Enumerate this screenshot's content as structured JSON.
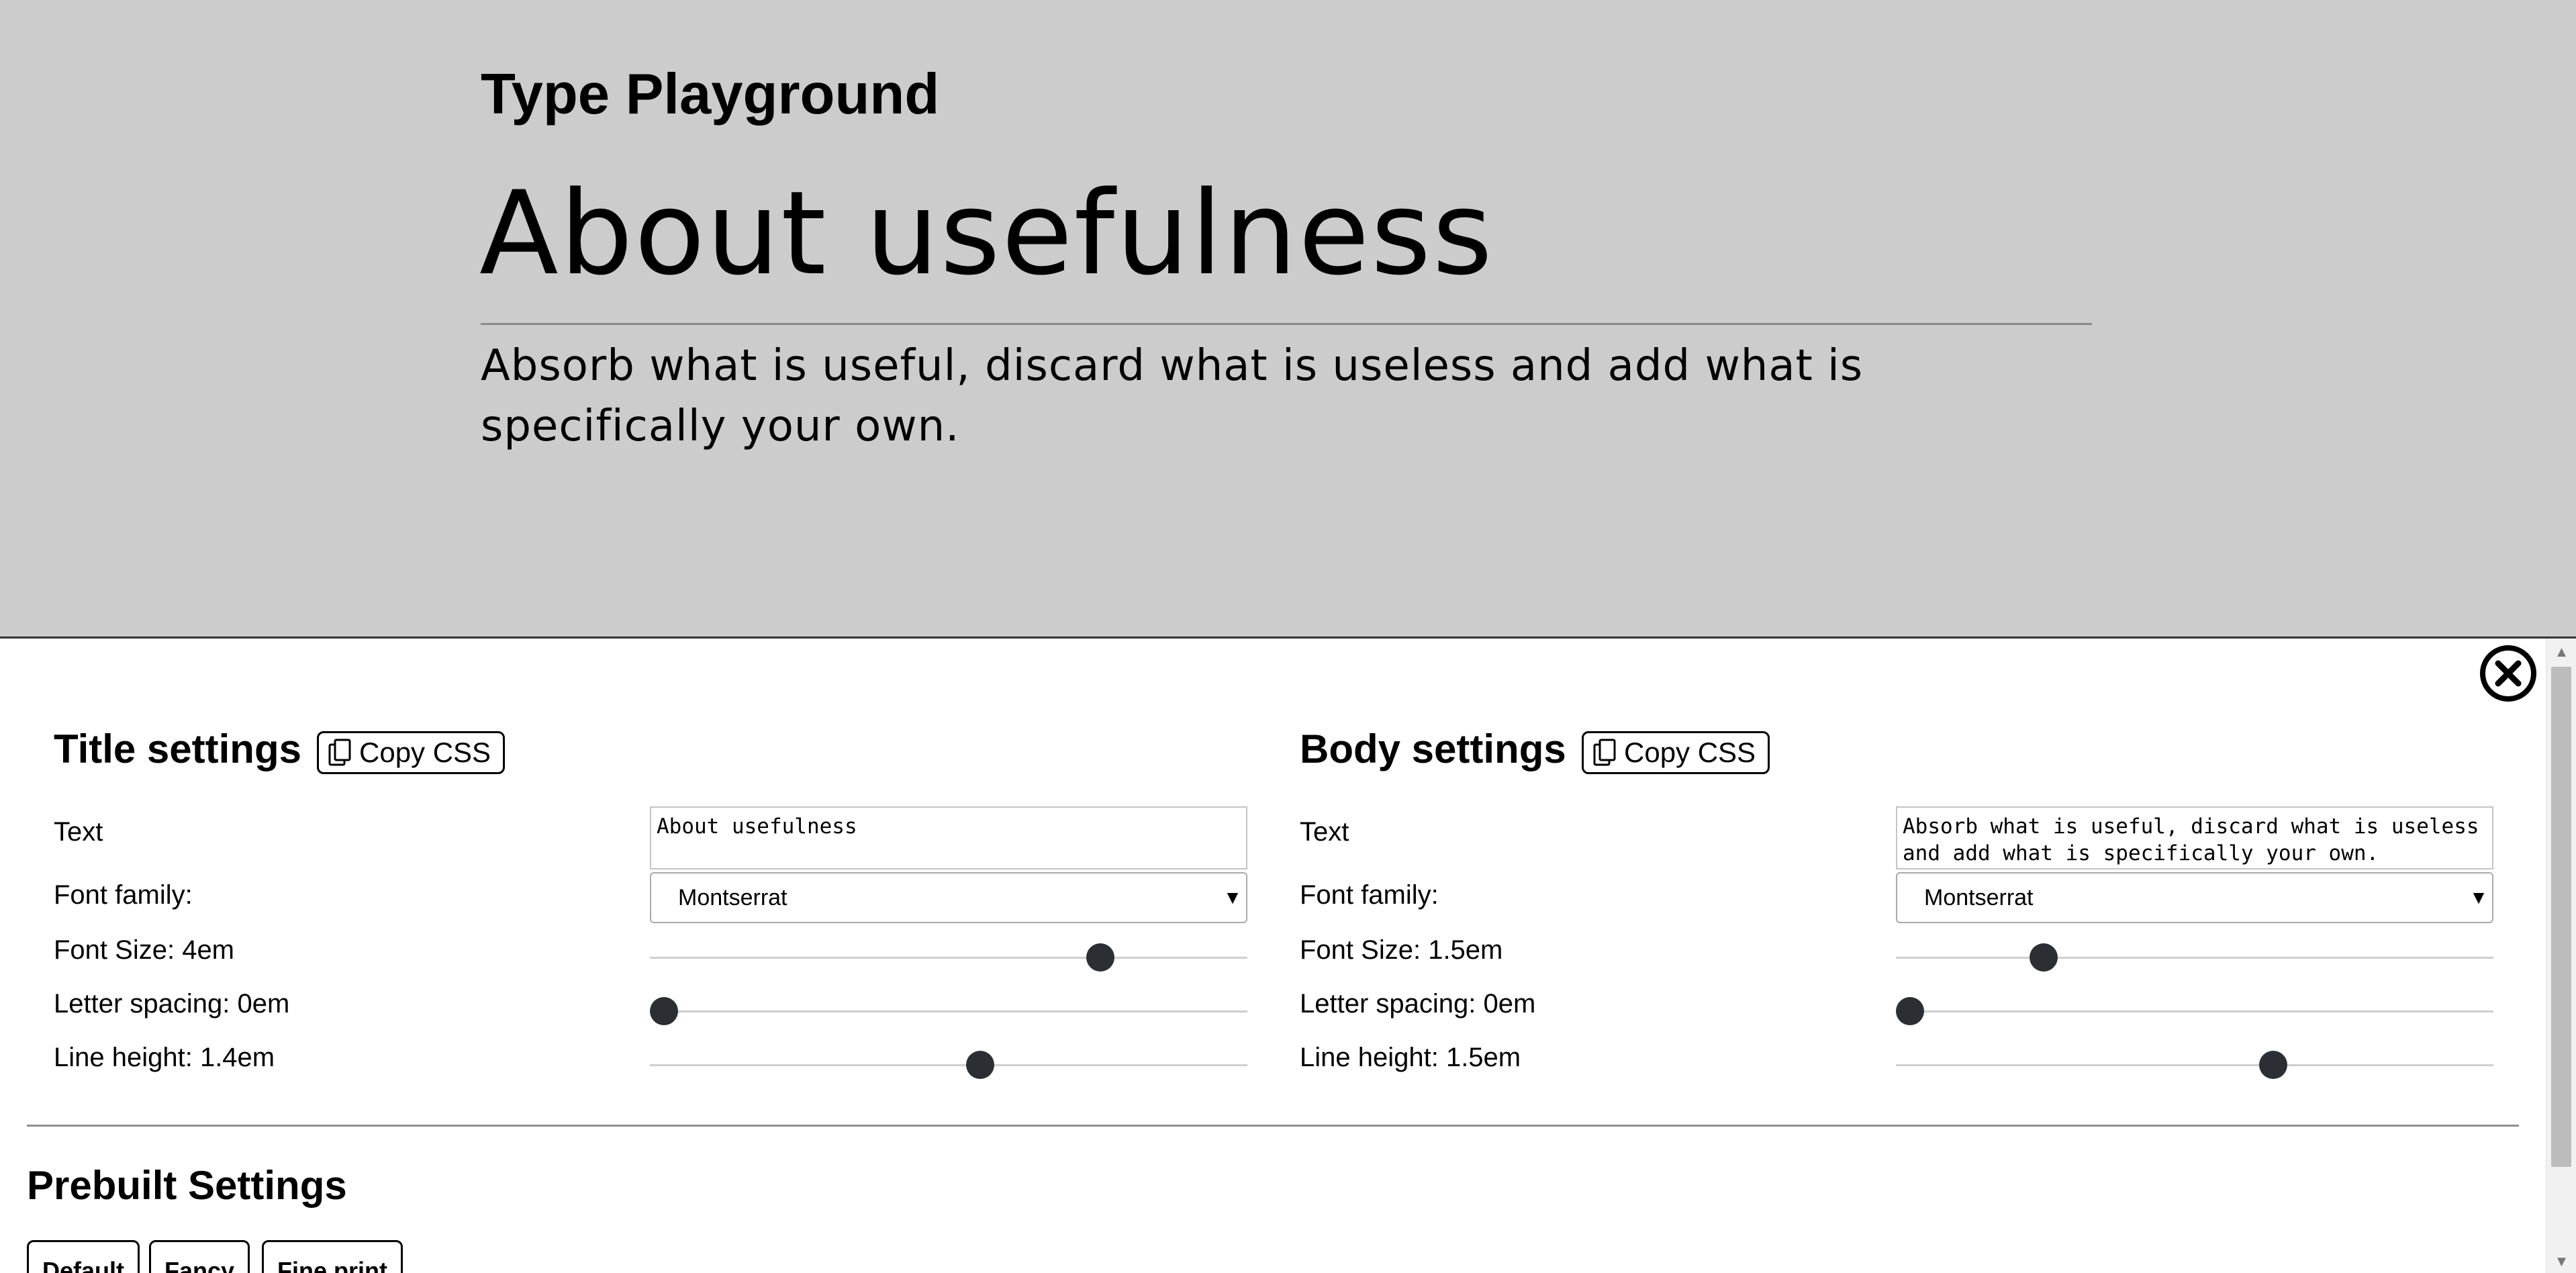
{
  "app": {
    "title": "Type Playground"
  },
  "preview": {
    "heading": "About usefulness",
    "body": "Absorb what is useful, discard what is useless and add what is specifically your own."
  },
  "title_settings": {
    "heading": "Title settings",
    "copy_label": "Copy CSS",
    "text_label": "Text",
    "text_value": "About usefulness",
    "font_family_label": "Font family:",
    "font_family_value": "Montserrat",
    "font_size_label": "Font Size: 4em",
    "font_size_level": 0.766,
    "letter_spacing_label": "Letter spacing: 0em",
    "letter_spacing_level": 0.0,
    "line_height_label": "Line height: 1.4em",
    "line_height_level": 0.556
  },
  "body_settings": {
    "heading": "Body settings",
    "copy_label": "Copy CSS",
    "text_label": "Text",
    "text_value": "Absorb what is useful, discard what is useless\nand add what is specifically your own.",
    "font_family_label": "Font family:",
    "font_family_value": "Montserrat",
    "font_size_label": "Font Size: 1.5em",
    "font_size_level": 0.235,
    "letter_spacing_label": "Letter spacing: 0em",
    "letter_spacing_level": 0.0,
    "line_height_label": "Line height: 1.5em",
    "line_height_level": 0.638
  },
  "prebuilt": {
    "heading": "Prebuilt Settings",
    "buttons": [
      "Default",
      "Fancy",
      "Fine print"
    ]
  },
  "icons": {
    "close": "close-circle-icon",
    "copy": "copy-icon",
    "select_caret": "caret-down-icon"
  }
}
